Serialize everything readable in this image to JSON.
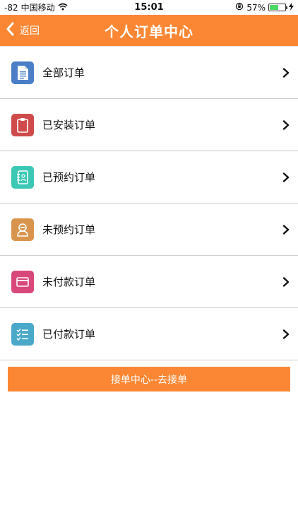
{
  "status_bar": {
    "signal": "-82",
    "carrier": "中国移动",
    "time": "15:01",
    "battery_percent": "57%",
    "battery_level": 0.57
  },
  "nav": {
    "back_label": "返回",
    "title": "个人订单中心"
  },
  "menu": {
    "items": [
      {
        "label": "全部订单",
        "icon": "document-icon",
        "color": "#4a7fc8"
      },
      {
        "label": "已安装订单",
        "icon": "clipboard-icon",
        "color": "#cf4b4b"
      },
      {
        "label": "已预约订单",
        "icon": "notebook-icon",
        "color": "#3cc8b4"
      },
      {
        "label": "未预约订单",
        "icon": "person-icon",
        "color": "#d9954e"
      },
      {
        "label": "未付款订单",
        "icon": "card-icon",
        "color": "#d9487a"
      },
      {
        "label": "已付款订单",
        "icon": "checklist-icon",
        "color": "#4aa8c8"
      }
    ]
  },
  "cta": {
    "label": "接单中心--去接单"
  },
  "colors": {
    "accent": "#fb8734"
  }
}
